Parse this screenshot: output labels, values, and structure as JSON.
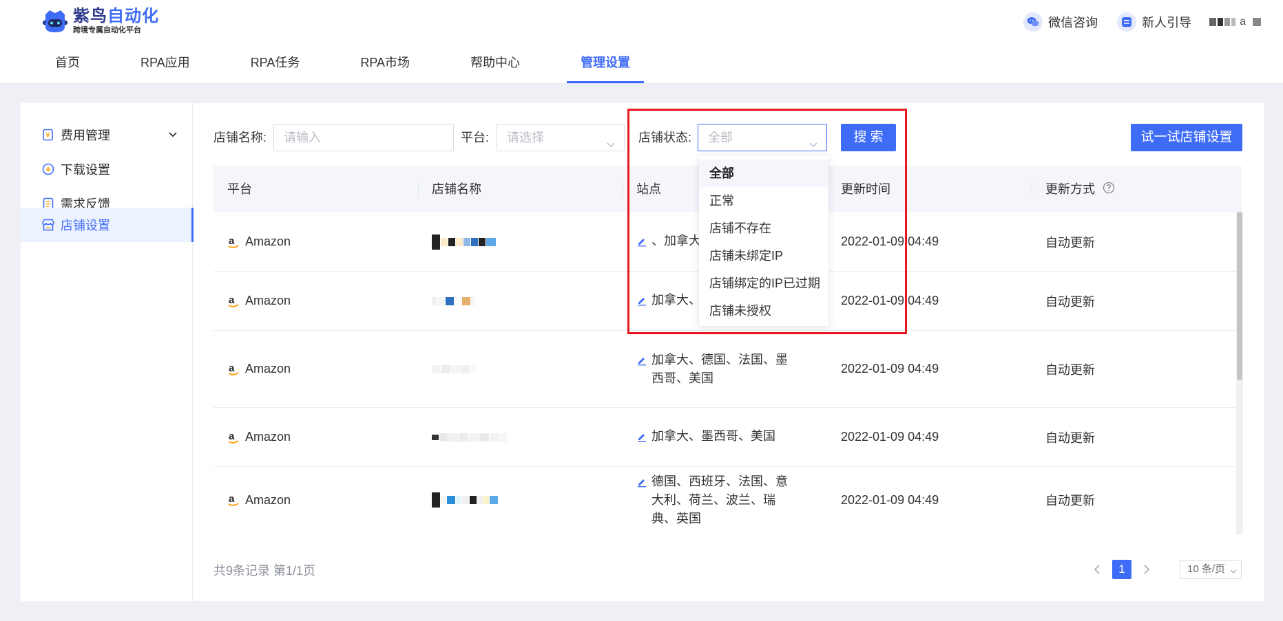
{
  "app": {
    "logo_title_main": "紫鸟",
    "logo_title_accent": "自动化",
    "logo_subtitle": "跨境专属自动化平台"
  },
  "header": {
    "wechat_label": "微信咨询",
    "guide_label": "新人引导",
    "user_suffix": "a"
  },
  "nav": {
    "items": [
      {
        "label": "首页"
      },
      {
        "label": "RPA应用"
      },
      {
        "label": "RPA任务"
      },
      {
        "label": "RPA市场"
      },
      {
        "label": "帮助中心"
      },
      {
        "label": "管理设置",
        "active": true
      }
    ]
  },
  "sidebar": {
    "items": [
      {
        "label": "费用管理"
      },
      {
        "label": "下载设置"
      },
      {
        "label": "需求反馈"
      },
      {
        "label": "店铺设置",
        "active": true
      }
    ]
  },
  "filters": {
    "store_name_label": "店铺名称:",
    "store_name_placeholder": "请输入",
    "platform_label": "平台:",
    "platform_placeholder": "请选择",
    "status_label": "店铺状态:",
    "status_value": "全部",
    "search_button": "搜 索",
    "try_button": "试一试店铺设置"
  },
  "table": {
    "columns": [
      "平台",
      "店铺名称",
      "站点",
      "更新时间",
      "更新方式"
    ],
    "rows": [
      {
        "platform": "Amazon",
        "site": "、加拿大",
        "updated": "2022-01-09 04:49",
        "method": "自动更新"
      },
      {
        "platform": "Amazon",
        "site": "加拿大、",
        "updated": "2022-01-09 04:49",
        "method": "自动更新"
      },
      {
        "platform": "Amazon",
        "site": "加拿大、德国、法国、墨西哥、美国",
        "updated": "2022-01-09 04:49",
        "method": "自动更新"
      },
      {
        "platform": "Amazon",
        "site": "加拿大、墨西哥、美国",
        "updated": "2022-01-09 04:49",
        "method": "自动更新"
      },
      {
        "platform": "Amazon",
        "site": "德国、西班牙、法国、意大利、荷兰、波兰、瑞典、英国",
        "updated": "2022-01-09 04:49",
        "method": "自动更新"
      }
    ]
  },
  "dropdown": {
    "options": [
      "全部",
      "正常",
      "店铺不存在",
      "店铺未绑定IP",
      "店铺绑定的IP已过期",
      "店铺未授权"
    ],
    "selected": "全部"
  },
  "footer": {
    "count_text": "共9条记录 第1/1页",
    "current_page": "1",
    "page_size": "10 条/页"
  },
  "colors": {
    "primary": "#3f6cf6",
    "highlight_box": "#e8161e"
  }
}
